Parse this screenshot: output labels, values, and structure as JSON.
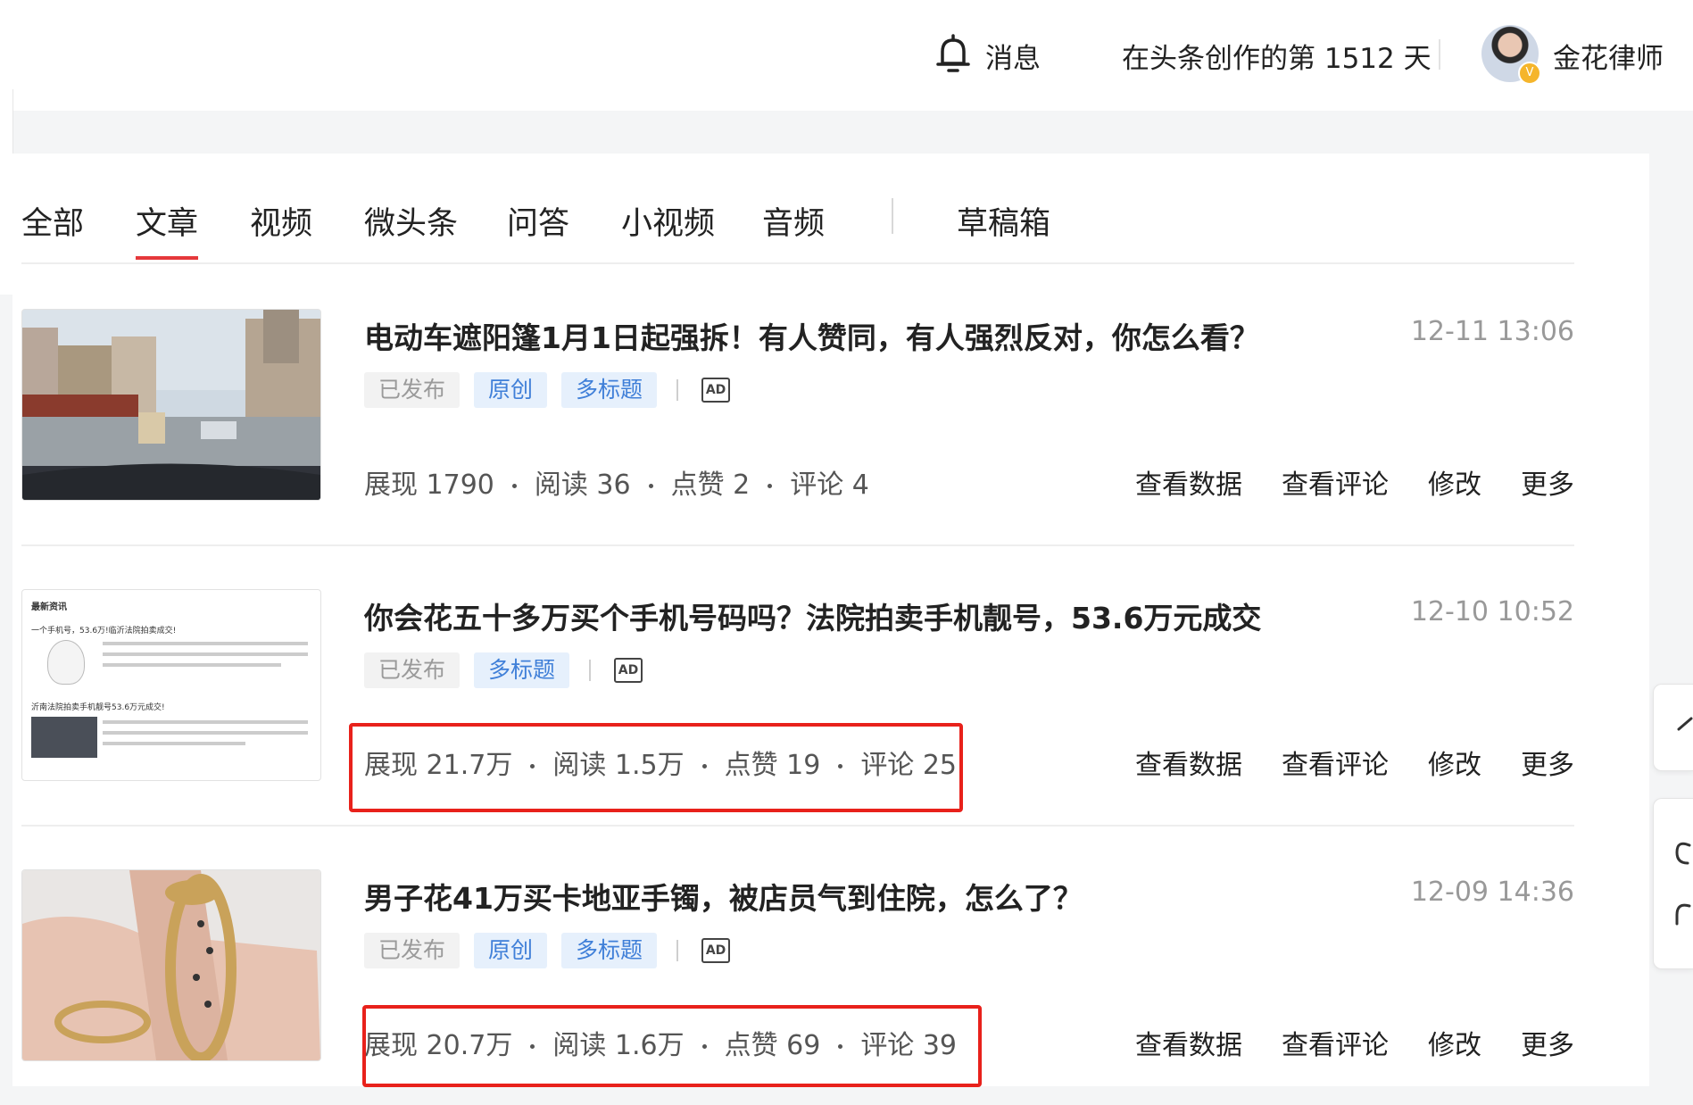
{
  "header": {
    "message_label": "消息",
    "creation_days": "在头条创作的第 1512 天",
    "username": "金花律师",
    "badge": "V"
  },
  "tabs": [
    {
      "label": "全部",
      "active": false
    },
    {
      "label": "文章",
      "active": true
    },
    {
      "label": "视频",
      "active": false
    },
    {
      "label": "微头条",
      "active": false
    },
    {
      "label": "问答",
      "active": false
    },
    {
      "label": "小视频",
      "active": false
    },
    {
      "label": "音频",
      "active": false
    },
    {
      "label": "草稿箱",
      "active": false
    }
  ],
  "articles": [
    {
      "title": "电动车遮阳篷1月1日起强拆！有人赞同，有人强烈反对，你怎么看？",
      "date": "12-11 13:06",
      "tags": [
        "已发布",
        "原创",
        "多标题"
      ],
      "ad": "AD",
      "stats": [
        "展现 1790",
        "阅读 36",
        "点赞 2",
        "评论 4"
      ],
      "actions": [
        "查看数据",
        "查看评论",
        "修改",
        "更多"
      ]
    },
    {
      "title": "你会花五十多万买个手机号码吗？法院拍卖手机靓号，53.6万元成交",
      "date": "12-10 10:52",
      "tags": [
        "已发布",
        "多标题"
      ],
      "ad": "AD",
      "stats": [
        "展现 21.7万",
        "阅读 1.5万",
        "点赞 19",
        "评论 25"
      ],
      "actions": [
        "查看数据",
        "查看评论",
        "修改",
        "更多"
      ],
      "thumb_text": {
        "heading": "最新资讯",
        "line1": "一个手机号，53.6万!临沂法院拍卖成交!",
        "line2": "沂南法院拍卖手机靓号53.6万元成交!"
      }
    },
    {
      "title": "男子花41万买卡地亚手镯，被店员气到住院，怎么了？",
      "date": "12-09 14:36",
      "tags": [
        "已发布",
        "原创",
        "多标题"
      ],
      "ad": "AD",
      "stats": [
        "展现 20.7万",
        "阅读 1.6万",
        "点赞 69",
        "评论 39"
      ],
      "actions": [
        "查看数据",
        "查看评论",
        "修改",
        "更多"
      ]
    }
  ],
  "colors": {
    "accent_red": "#e5383b",
    "tag_blue": "#3f7fd8",
    "highlight_box": "#e8211b"
  }
}
